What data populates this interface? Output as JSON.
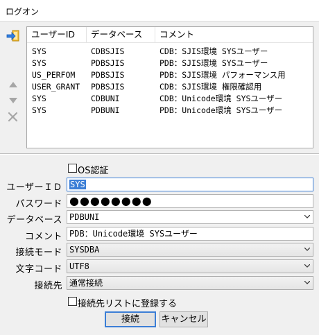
{
  "window": {
    "title": "ログオン"
  },
  "side_icons": [
    "login-icon",
    "arrow-up-icon",
    "arrow-down-icon",
    "delete-icon"
  ],
  "list": {
    "columns": [
      "ユーザーID",
      "データベース",
      "コメント"
    ],
    "rows": [
      {
        "user": "SYS",
        "db": "CDBSJIS",
        "comment": "CDB：SJIS環境 SYSユーザー"
      },
      {
        "user": "SYS",
        "db": "PDBSJIS",
        "comment": "PDB：SJIS環境 SYSユーザー"
      },
      {
        "user": "US_PERFOM",
        "db": "PDBSJIS",
        "comment": "PDB：SJIS環境 パフォーマンス用"
      },
      {
        "user": "USER_GRANT",
        "db": "PDBSJIS",
        "comment": "CDB：SJIS環境 権限確認用"
      },
      {
        "user": "SYS",
        "db": "CDBUNI",
        "comment": "CDB：Unicode環境 SYSユーザー"
      },
      {
        "user": "SYS",
        "db": "PDBUNI",
        "comment": "PDB：Unicode環境 SYSユーザー"
      }
    ]
  },
  "form": {
    "os_auth_label": "OS認証",
    "user_id_label": "ユーザーＩＤ",
    "user_id_value": "SYS",
    "password_label": "パスワード",
    "password_value": "●●●●●●●●",
    "database_label": "データベース",
    "database_value": "PDBUNI",
    "comment_label": "コメント",
    "comment_value": "PDB：Unicode環境 SYSユーザー",
    "connect_mode_label": "接続モード",
    "connect_mode_value": "SYSDBA",
    "charset_label": "文字コード",
    "charset_value": "UTF8",
    "destination_label": "接続先",
    "destination_value": "通常接続",
    "register_label": "接続先リストに登録する"
  },
  "buttons": {
    "connect": "接続",
    "cancel": "キャンセル"
  },
  "colors": {
    "accent": "#3b7ed6",
    "disabled_icon": "#a6a6a6",
    "login_icon": "#e8a317"
  }
}
